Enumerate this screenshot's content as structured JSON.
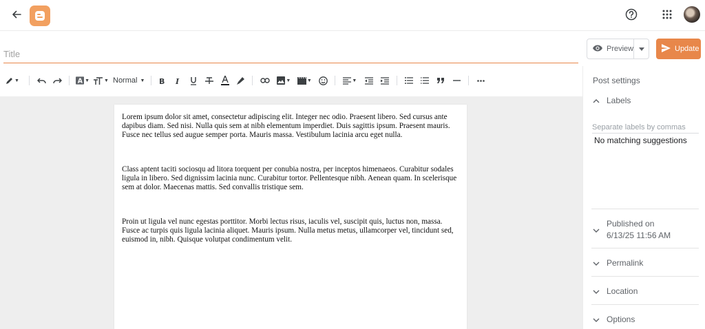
{
  "header": {
    "back_icon": "arrow-back-icon",
    "logo_icon": "blogger-logo",
    "brand_color": "#f2a060",
    "help_icon": "help-circle-icon",
    "apps_icon": "apps-grid-icon"
  },
  "title_field": {
    "placeholder": "Title",
    "value": "",
    "accent": "#e8874a"
  },
  "actions": {
    "preview_label": "Preview",
    "update_label": "Update",
    "update_color": "#e8874a"
  },
  "toolbar": {
    "font_size_label": "Normal",
    "icons": [
      "pen-icon",
      "undo-icon",
      "redo-icon",
      "text-style-icon",
      "text-size-icon",
      "bold-icon",
      "italic-icon",
      "underline-icon",
      "strikethrough-icon",
      "text-color-icon",
      "highlight-icon",
      "link-icon",
      "image-icon",
      "video-icon",
      "emoji-icon",
      "align-icon",
      "indent-decrease-icon",
      "indent-increase-icon",
      "bulleted-list-icon",
      "numbered-list-icon",
      "quote-icon",
      "horizontal-rule-icon",
      "more-icon"
    ]
  },
  "editor": {
    "paragraphs": [
      " Lorem ipsum dolor sit amet, consectetur adipiscing elit. Integer nec odio. Praesent libero. Sed cursus ante dapibus diam. Sed nisi. Nulla quis sem at nibh elementum imperdiet. Duis sagittis ipsum. Praesent mauris. Fusce nec tellus sed augue semper porta. Mauris massa. Vestibulum lacinia arcu eget nulla.",
      "Class aptent taciti sociosqu ad litora torquent per conubia nostra, per inceptos himenaeos. Curabitur sodales ligula in libero. Sed dignissim lacinia nunc. Curabitur tortor. Pellentesque nibh. Aenean quam. In scelerisque sem at dolor. Maecenas mattis. Sed convallis tristique sem.",
      "Proin ut ligula vel nunc egestas porttitor. Morbi lectus risus, iaculis vel, suscipit quis, luctus non, massa. Fusce ac turpis quis ligula lacinia aliquet. Mauris ipsum. Nulla metus metus, ullamcorper vel, tincidunt sed, euismod in, nibh. Quisque volutpat condimentum velit."
    ]
  },
  "settings": {
    "title": "Post settings",
    "labels": {
      "heading": "Labels",
      "placeholder": "Separate labels by commas",
      "no_match": "No matching suggestions"
    },
    "published": {
      "heading": "Published on",
      "value": "6/13/25 11:56 AM"
    },
    "permalink": "Permalink",
    "location": "Location",
    "options": "Options"
  }
}
